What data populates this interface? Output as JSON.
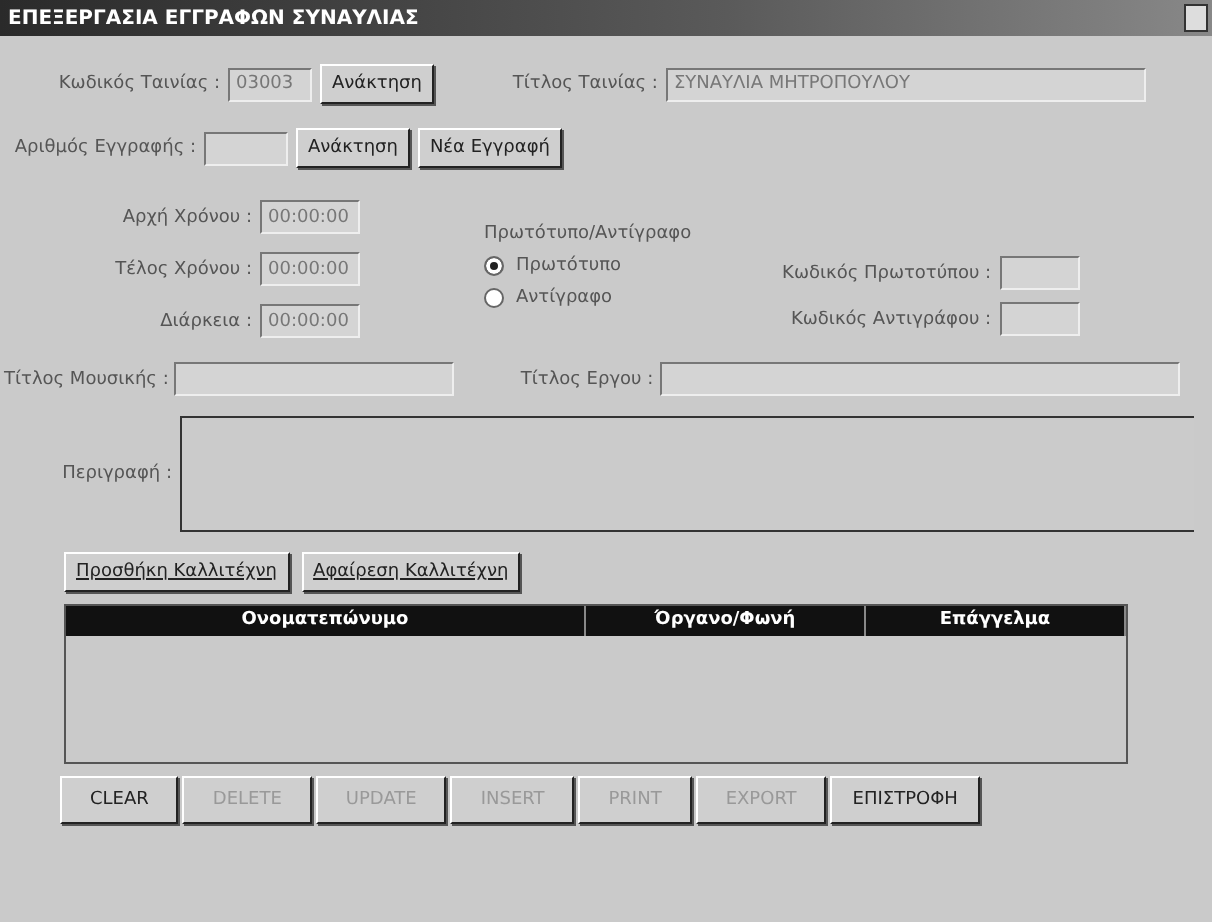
{
  "window": {
    "title": "ΕΠΕΞΕΡΓΑΣΙΑ ΕΓΓΡΑΦΩΝ ΣΥΝΑΥΛΙΑΣ"
  },
  "tape": {
    "label": "Κωδικός Ταινίας :",
    "value": "03003",
    "button": "Ανάκτηση",
    "title_label": "Τίτλος Ταινίας :",
    "title_value": "ΣΥΝΑΥΛΙΑ ΜΗΤΡΟΠΟΥΛΟΥ"
  },
  "record": {
    "label": "Αριθμός Εγγραφής :",
    "buttons": [
      "Ανάκτηση",
      "Νέα Εγγραφή"
    ]
  },
  "times": [
    {
      "label": "Αρχή Χρόνου :",
      "value": "00:00:00"
    },
    {
      "label": "Τέλος Χρόνου :",
      "value": "00:00:00"
    },
    {
      "label": "Διάρκεια :",
      "value": "00:00:00"
    }
  ],
  "copy_type": {
    "label": "Πρωτότυπο/Αντίγραφο",
    "options": [
      {
        "label": "Πρωτότυπο",
        "selected": true
      },
      {
        "label": "Αντίγραφο",
        "selected": false
      }
    ]
  },
  "codes": [
    {
      "label": "Κωδικός Πρωτοτύπου :"
    },
    {
      "label": "Κωδικός Αντιγράφου :"
    }
  ],
  "music_title": {
    "label": "Τίτλος Μουσικής :"
  },
  "work_title": {
    "label": "Τίτλος Εργου :"
  },
  "description": {
    "label": "Περιγραφή :"
  },
  "artist_buttons": [
    "Προσθήκη Καλλιτέχνη",
    "Αφαίρεση Καλλιτέχνη"
  ],
  "table": {
    "columns": [
      "Ονοματεπώνυμο",
      "Όργανο/Φωνή",
      "Επάγγελμα"
    ]
  },
  "actions": [
    {
      "label": "CLEAR",
      "disabled": false
    },
    {
      "label": "DELETE",
      "disabled": true
    },
    {
      "label": "UPDATE",
      "disabled": true
    },
    {
      "label": "INSERT",
      "disabled": true
    },
    {
      "label": "PRINT",
      "disabled": true
    },
    {
      "label": "EXPORT",
      "disabled": true
    },
    {
      "label": "ΕΠΙΣΤΡΟΦΗ",
      "disabled": false
    }
  ]
}
